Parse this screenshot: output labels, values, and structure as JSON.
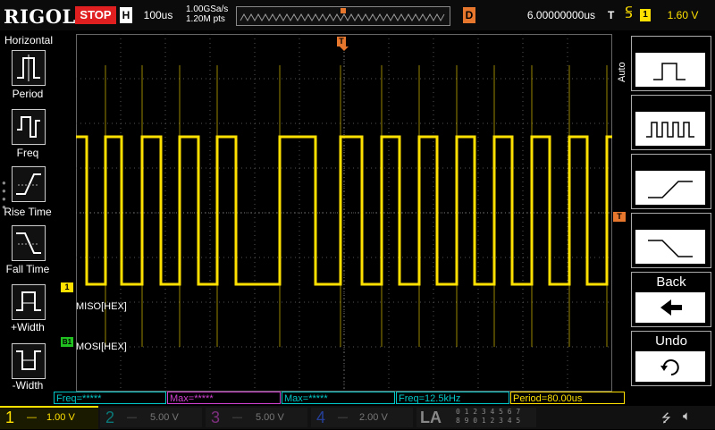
{
  "header": {
    "logo": "RIGOL",
    "run_state": "STOP",
    "horizontal_label": "H",
    "horizontal_scale": "100us",
    "sample_rate": "1.00GSa/s",
    "memory_depth": "1.20M pts",
    "delay_label": "D",
    "delay_value": "6.00000000us",
    "trigger_label": "T",
    "trigger_source": "1",
    "trigger_level": "1.60 V"
  },
  "left_menu": {
    "title": "Horizontal",
    "items": [
      {
        "label": "Period",
        "icon": "period-icon"
      },
      {
        "label": "Freq",
        "icon": "freq-icon"
      },
      {
        "label": "Rise Time",
        "icon": "rise-time-icon"
      },
      {
        "label": "Fall Time",
        "icon": "fall-time-icon"
      },
      {
        "label": "+Width",
        "icon": "positive-width-icon"
      },
      {
        "label": "-Width",
        "icon": "negative-width-icon"
      }
    ]
  },
  "right_menu": {
    "auto_label": "Auto",
    "softkeys": [
      {
        "icon": "single-pulse-icon"
      },
      {
        "icon": "pulse-train-icon"
      },
      {
        "icon": "rising-edge-icon"
      },
      {
        "icon": "falling-edge-icon"
      },
      {
        "label": "Back",
        "icon": "back-arrow-icon"
      },
      {
        "label": "Undo",
        "icon": "undo-icon"
      }
    ]
  },
  "waveform": {
    "channel1_marker": "1",
    "bus_marker": "B1",
    "miso_label": "MISO[HEX]",
    "mosi_label": "MOSI[HEX]",
    "trigger_marker": "T"
  },
  "measurements": [
    {
      "label": "Freq=*****",
      "color": "#00c8c8"
    },
    {
      "label": "Max=*****",
      "color": "#d040d0"
    },
    {
      "label": "Max=*****",
      "color": "#00c8c8"
    },
    {
      "label": "Freq=12.5kHz",
      "color": "#00c8c8"
    },
    {
      "label": "Period=80.00us",
      "color": "#ffe000"
    }
  ],
  "channels": [
    {
      "num": "1",
      "scale": "1.00 V",
      "color": "#ffe000",
      "active": true
    },
    {
      "num": "2",
      "scale": "5.00 V",
      "color": "#00c8c8",
      "active": false
    },
    {
      "num": "3",
      "scale": "5.00 V",
      "color": "#d040d0",
      "active": false
    },
    {
      "num": "4",
      "scale": "2.00 V",
      "color": "#3060ff",
      "active": false
    }
  ],
  "la": {
    "label": "LA",
    "row1": "0 1 2 3  4 5 6 7",
    "row2": "8 9 0 1  2 3 4 5"
  },
  "colors": {
    "channel1": "#ffe000",
    "accent_orange": "#e8772e",
    "stop_red": "#e02020",
    "bus_green": "#20c020"
  }
}
